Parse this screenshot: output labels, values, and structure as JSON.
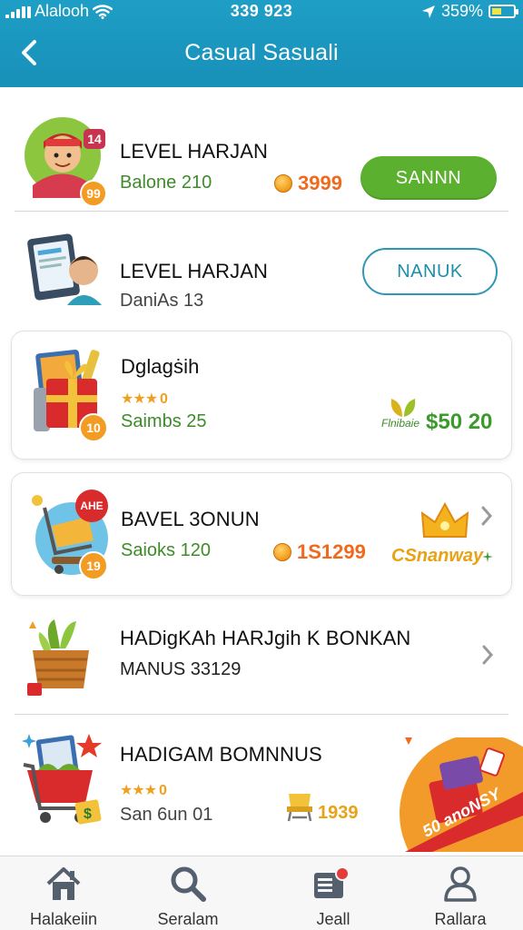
{
  "status_bar": {
    "carrier": "Alalooh",
    "time": "339 923",
    "battery": "359%"
  },
  "header": {
    "title": "Casual Sasuali"
  },
  "items": [
    {
      "name": "LEVEL HARJAN",
      "subtitle": "Balone 210",
      "coin_value": "3999",
      "action_label": "SANNN",
      "badge": "14",
      "level_badge": "99"
    },
    {
      "name": "LEVEL HARJAN",
      "subtitle": "DaniAs 13",
      "action_label": "NANUK"
    },
    {
      "name": "Dglagṡih",
      "rating": "0",
      "subtitle": "Saimbs 25",
      "price_caption": "Flnibaie",
      "price": "$50 20",
      "level_badge": "10"
    },
    {
      "name": "BAVEL 3ONUN",
      "subtitle": "Saioks 120",
      "coin_value": "1S1299",
      "reward_caption": "CSnanway",
      "badge": "AHE",
      "level_badge": "19"
    },
    {
      "name": "HADigKAh HARJgih K BONKAN",
      "subtitle": "MANUS 33129"
    },
    {
      "name": "HADIGAM BOMNNUS",
      "rating": "0",
      "subtitle": "San 6un 01",
      "value": "1939",
      "promo_text": "50 anoNSY"
    }
  ],
  "bottom_nav": [
    {
      "label": "Halakeiin",
      "icon": "home-icon"
    },
    {
      "label": "Seralam",
      "icon": "search-icon"
    },
    {
      "label": "Jeall",
      "icon": "inbox-icon"
    },
    {
      "label": "Rallara",
      "icon": "profile-icon"
    }
  ],
  "colors": {
    "header": "#1c99c1",
    "primary_button": "#5cb030",
    "outline_button": "#2f97b4",
    "coin_text": "#f06a1e",
    "subtitle_green": "#3d8b2a",
    "price_green": "#3a9a2a"
  }
}
